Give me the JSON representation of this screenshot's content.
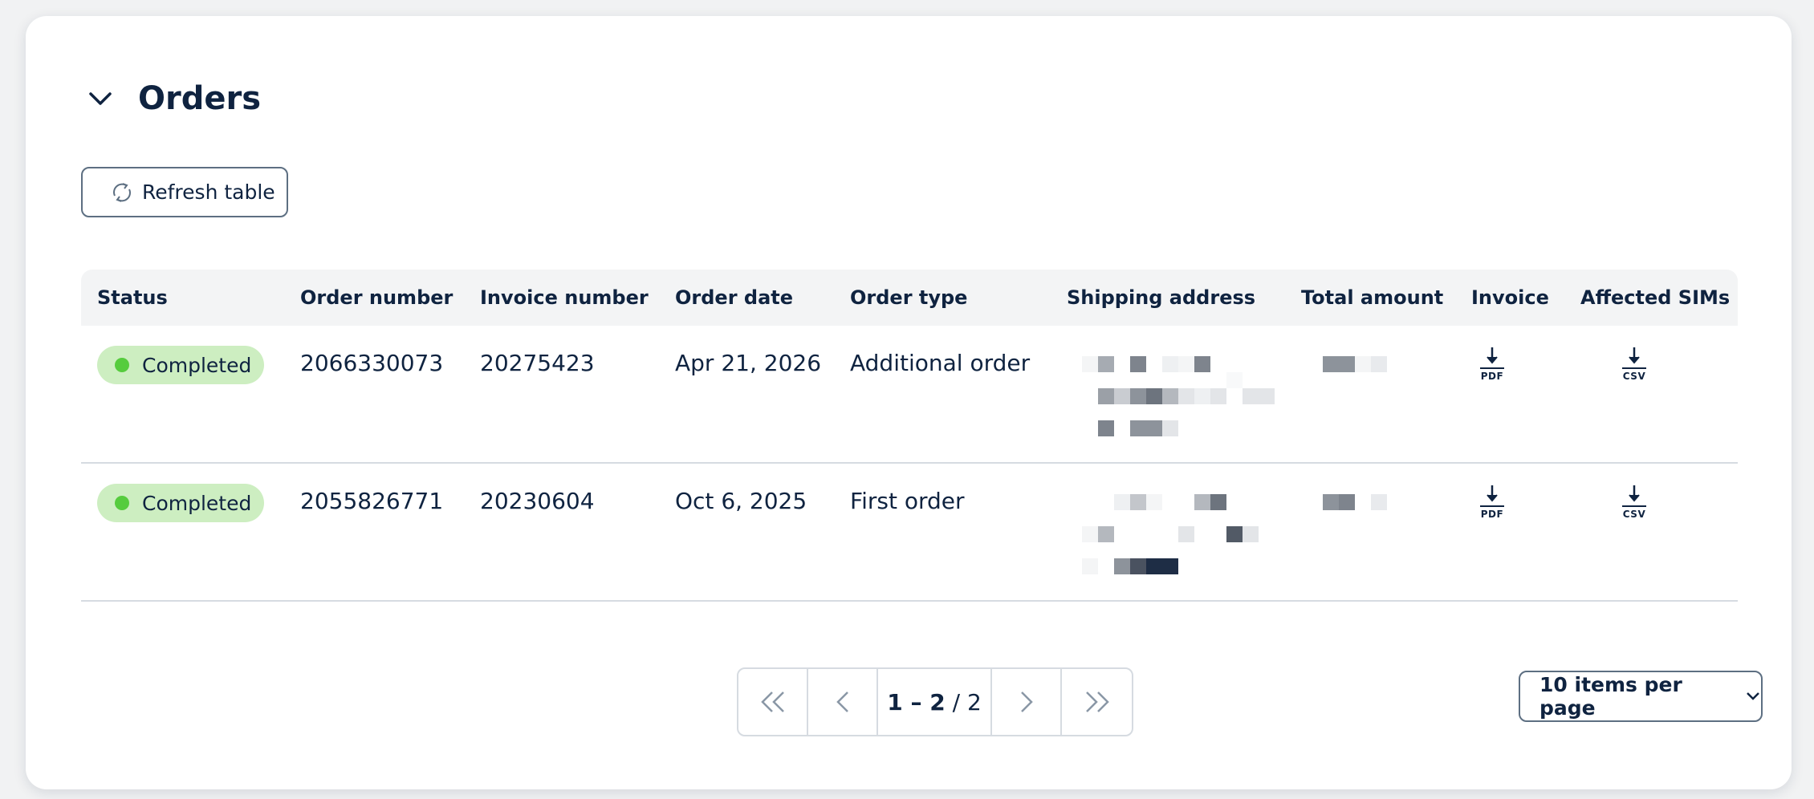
{
  "section": {
    "title": "Orders",
    "collapse_icon": "chevron-down-icon"
  },
  "toolbar": {
    "refresh_label": "Refresh table",
    "refresh_icon": "refresh-icon"
  },
  "table": {
    "columns": [
      "Status",
      "Order number",
      "Invoice number",
      "Order date",
      "Order type",
      "Shipping address",
      "Total amount",
      "Invoice",
      "Affected SIMs"
    ],
    "rows": [
      {
        "status": "Completed",
        "order_number": "2066330073",
        "invoice_number": "20275423",
        "order_date": "Apr 21, 2026",
        "order_type": "Additional order",
        "invoice_file": "PDF",
        "sims_file": "CSV"
      },
      {
        "status": "Completed",
        "order_number": "2055826771",
        "invoice_number": "20230604",
        "order_date": "Oct 6, 2025",
        "order_type": "First order",
        "invoice_file": "PDF",
        "sims_file": "CSV"
      }
    ]
  },
  "pagination": {
    "range": "1 – 2",
    "total": "/ 2"
  },
  "per_page": {
    "label": "10 items per page"
  },
  "colors": {
    "status_badge_bg": "#cdeec1",
    "status_dot": "#56cc3e",
    "text": "#0f2340"
  }
}
